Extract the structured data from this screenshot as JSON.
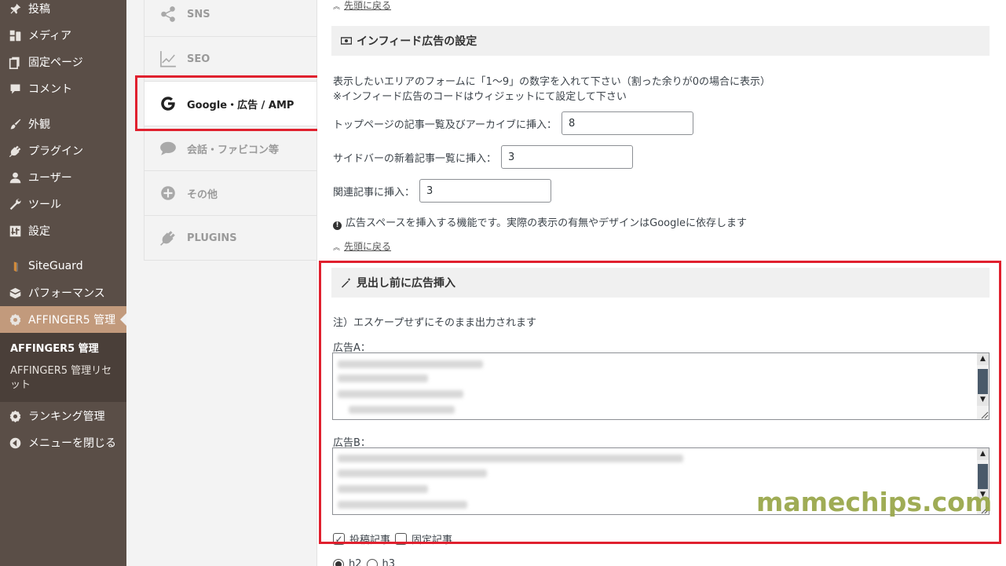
{
  "admin_menu": {
    "items": [
      {
        "label": "投稿",
        "icon": "pin-icon"
      },
      {
        "label": "メディア",
        "icon": "media-icon"
      },
      {
        "label": "固定ページ",
        "icon": "page-icon"
      },
      {
        "label": "コメント",
        "icon": "comment-icon"
      },
      {
        "label": "外観",
        "icon": "brush-icon"
      },
      {
        "label": "プラグイン",
        "icon": "plugin-icon"
      },
      {
        "label": "ユーザー",
        "icon": "user-icon"
      },
      {
        "label": "ツール",
        "icon": "wrench-icon"
      },
      {
        "label": "設定",
        "icon": "settings-icon"
      },
      {
        "label": "SiteGuard",
        "icon": "siteguard-icon"
      },
      {
        "label": "パフォーマンス",
        "icon": "performance-icon"
      },
      {
        "label": "AFFINGER5 管理",
        "icon": "gear-icon"
      },
      {
        "label": "ランキング管理",
        "icon": "gear-icon"
      },
      {
        "label": "メニューを閉じる",
        "icon": "collapse-icon"
      }
    ],
    "submenu": [
      "AFFINGER5 管理",
      "AFFINGER5 管理リセット"
    ]
  },
  "tabs": [
    {
      "label": "SNS",
      "icon": "share-icon"
    },
    {
      "label": "SEO",
      "icon": "chart-icon"
    },
    {
      "label": "Google・広告 / AMP",
      "icon": "google-icon",
      "active": true
    },
    {
      "label": "会話・ファビコン等",
      "icon": "speech-icon"
    },
    {
      "label": "その他",
      "icon": "plus-circle-icon"
    },
    {
      "label": "PLUGINS",
      "icon": "plugin-icon"
    }
  ],
  "main": {
    "back_to_top": "先頭に戻る",
    "infeed": {
      "header": "インフィード広告の設定",
      "desc1": "表示したいエリアのフォームに「1〜9」の数字を入れて下さい（割った余りが0の場合に表示）",
      "desc2": "※インフィード広告のコードはウィジェットにて設定して下さい",
      "field1_label": "トップページの記事一覧及びアーカイブに挿入：",
      "field1_value": "8",
      "field2_label": "サイドバーの新着記事一覧に挿入：",
      "field2_value": "3",
      "field3_label": "関連記事に挿入：",
      "field3_value": "3",
      "note": "広告スペースを挿入する機能です。実際の表示の有無やデザインはGoogleに依存します"
    },
    "heading_ads": {
      "header": "見出し前に広告挿入",
      "note": "注）エスケープせずにそのまま出力されます",
      "ad_a_label": "広告A：",
      "ad_b_label": "広告B：",
      "check_post": "投稿記事",
      "check_page": "固定記事",
      "radio_h2": "h2",
      "radio_h3": "h3"
    }
  },
  "watermark": "mamechips.com",
  "colors": {
    "highlight": "#e0202e",
    "sidebar": "#5a4e47",
    "current_menu": "#c29a7c"
  }
}
